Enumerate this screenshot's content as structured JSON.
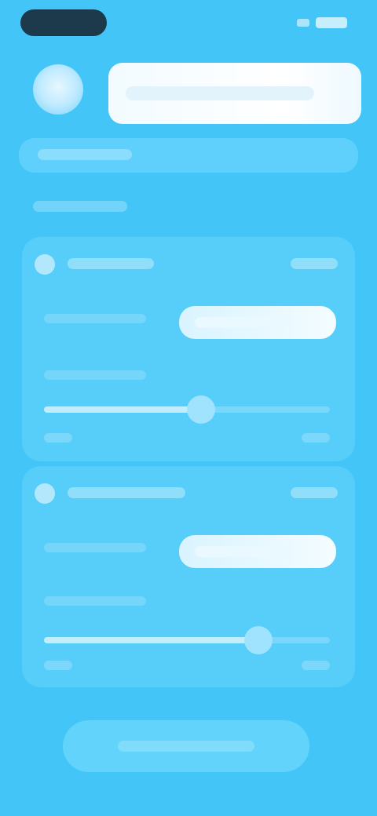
{
  "status": {
    "time": "",
    "battery": ""
  },
  "header": {
    "title": ""
  },
  "subtitle": "",
  "sections": [
    {
      "label": "",
      "row": {
        "label": "",
        "value": ""
      },
      "select": {
        "label": "",
        "value": ""
      },
      "slider": {
        "label": "",
        "min": "",
        "max": "",
        "level": 0.55
      }
    },
    {
      "label": "",
      "row": {
        "label": "",
        "value": ""
      },
      "select": {
        "label": "",
        "value": ""
      },
      "slider": {
        "label": "",
        "min": "",
        "max": "",
        "level": 0.75
      }
    }
  ],
  "primary_button": {
    "label": ""
  },
  "colors": {
    "background": "#43c6f7",
    "card": "#57cdf9",
    "accent": "#ffffff"
  }
}
